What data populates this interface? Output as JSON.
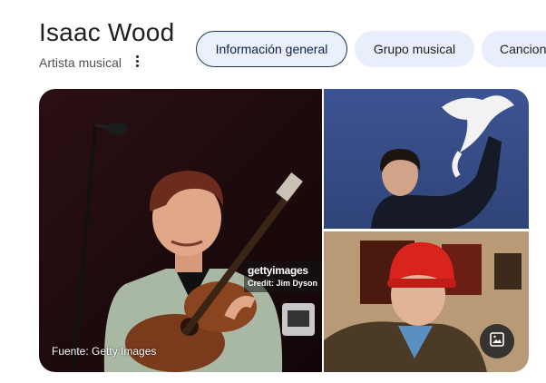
{
  "header": {
    "title": "Isaac Wood",
    "subtitle": "Artista musical",
    "more_icon": "more-vert-icon"
  },
  "chips": [
    {
      "label": "Información general",
      "selected": true
    },
    {
      "label": "Grupo musical",
      "selected": false
    },
    {
      "label": "Canciones",
      "selected": false
    }
  ],
  "gallery": {
    "main_image": {
      "getty_logo": "gettyimages",
      "credit": "Credit: Jim Dyson",
      "source": "Fuente: Getty Images"
    },
    "image_button_icon": "image-icon"
  },
  "colors": {
    "selected_chip_border": "#1f3760",
    "chip_background": "#e8eefb"
  }
}
